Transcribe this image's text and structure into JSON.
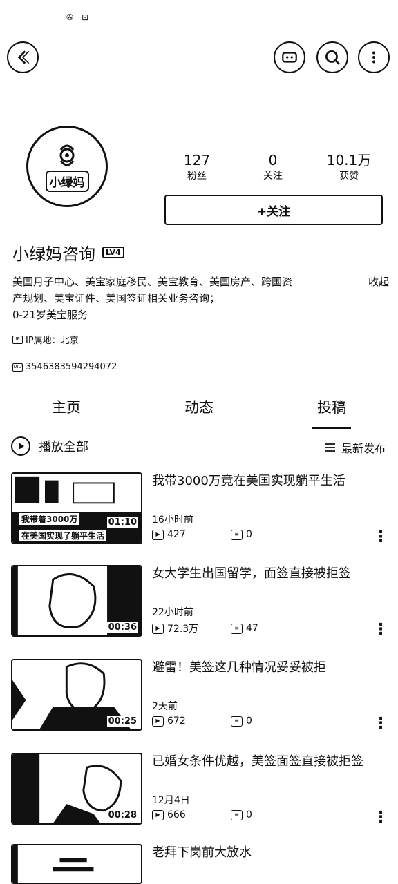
{
  "status_bar": {
    "icon1": "✇",
    "icon2": "⊡"
  },
  "top_bar": {
    "back_icon": "back-chevron-icon",
    "live_icon": "live-icon",
    "search_icon": "search-icon",
    "more_icon": "more-icon"
  },
  "profile": {
    "avatar_text": "小绿妈",
    "stats": [
      {
        "num": "127",
        "label": "粉丝"
      },
      {
        "num": "0",
        "label": "关注"
      },
      {
        "num": "10.1万",
        "label": "获赞"
      }
    ],
    "follow_label": "+关注",
    "name": "小绿妈咨询",
    "level_badge": "LV4",
    "bio_line1": "美国月子中心、美宝家庭移民、美宝教育、美国房产、跨国资",
    "bio_expand": "收起",
    "bio_line2": "产规划、美宝证件、美国签证相关业务咨询；",
    "bio_line3": "0-21岁美宝服务",
    "ip_location": "IP属地：北京",
    "uid": "3546383594294072"
  },
  "tabs": [
    {
      "label": "主页"
    },
    {
      "label": "动态"
    },
    {
      "label": "投稿"
    }
  ],
  "list_header": {
    "play_all": "播放全部",
    "sort": "最新发布"
  },
  "videos": [
    {
      "title": "我带3000万竟在美国实现躺平生活",
      "time": "16小时前",
      "views": "427",
      "comments": "0",
      "duration": "01:10",
      "caption_l1": "我带着3000万",
      "caption_l2": "在美国实现了躺平生活"
    },
    {
      "title": "女大学生出国留学，面签直接被拒签",
      "time": "22小时前",
      "views": "72.3万",
      "comments": "47",
      "duration": "00:36"
    },
    {
      "title": "避雷！美签这几种情况妥妥被拒",
      "time": "2天前",
      "views": "672",
      "comments": "0",
      "duration": "00:25"
    },
    {
      "title": "已婚女条件优越，美签面签直接被拒签",
      "time": "12月4日",
      "views": "666",
      "comments": "0",
      "duration": "00:28"
    },
    {
      "title": "老拜下岗前大放水"
    }
  ]
}
